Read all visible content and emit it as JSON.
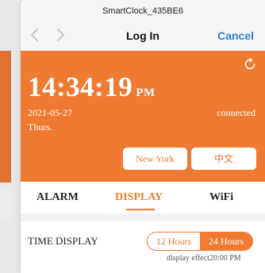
{
  "browser": {
    "url_title": "SmartClock_435BE6"
  },
  "nav": {
    "title": "Log In",
    "cancel_label": "Cancel",
    "back_icon": "chevron-left-icon",
    "forward_icon": "chevron-right-icon"
  },
  "clock": {
    "time": "14:34:19",
    "ampm": "PM",
    "date": "2021-05-27",
    "weekday": "Thurs.",
    "status": "connected",
    "city_button": "New York",
    "lang_button": "中文"
  },
  "tabs": [
    {
      "label": "ALARM",
      "active": false
    },
    {
      "label": "DISPLAY",
      "active": true
    },
    {
      "label": "WiFi",
      "active": false
    }
  ],
  "time_display": {
    "label": "TIME DISPLAY",
    "options": [
      "12 Hours",
      "24 Hours"
    ],
    "selected": "24 Hours",
    "effect_text": "display effect20:00 PM"
  },
  "colors": {
    "accent": "#ef7a32",
    "link": "#2b7de0"
  }
}
